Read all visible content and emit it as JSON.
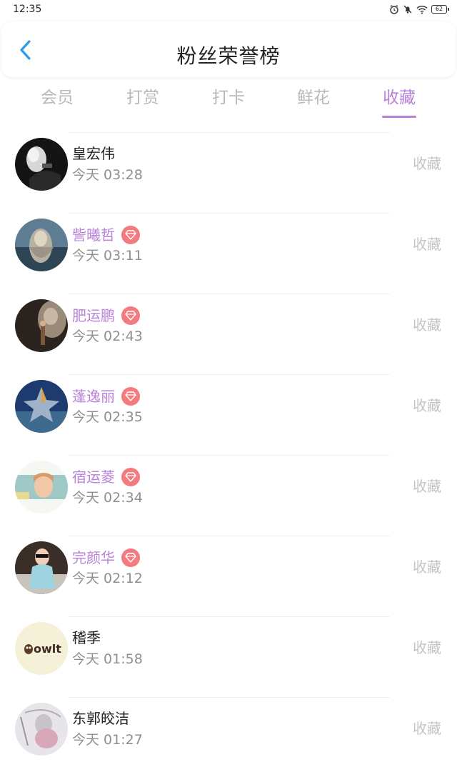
{
  "status_bar": {
    "time": "12:35",
    "battery": "62",
    "icons": [
      "alarm-icon",
      "mute-icon",
      "wifi-icon",
      "battery-icon"
    ]
  },
  "header": {
    "back_icon": "chevron-left-icon",
    "title": "粉丝荣誉榜"
  },
  "tabs": [
    {
      "label": "会员",
      "active": false
    },
    {
      "label": "打赏",
      "active": false
    },
    {
      "label": "打卡",
      "active": false
    },
    {
      "label": "鲜花",
      "active": false
    },
    {
      "label": "收藏",
      "active": true
    }
  ],
  "colors": {
    "accent": "#b882d8",
    "badge": "#f37b7f",
    "muted": "#c4c4c4",
    "time": "#8f8f8f",
    "back": "#2f9be8"
  },
  "rows": [
    {
      "name": "皇宏伟",
      "time": "今天 03:28",
      "action": "收藏",
      "vip": false
    },
    {
      "name": "訾曦哲",
      "time": "今天 03:11",
      "action": "收藏",
      "vip": true
    },
    {
      "name": "肥运鹏",
      "time": "今天 02:43",
      "action": "收藏",
      "vip": true
    },
    {
      "name": "蓬逸丽",
      "time": "今天 02:35",
      "action": "收藏",
      "vip": true
    },
    {
      "name": "宿运菱",
      "time": "今天 02:34",
      "action": "收藏",
      "vip": true
    },
    {
      "name": "完颜华",
      "time": "今天 02:12",
      "action": "收藏",
      "vip": true
    },
    {
      "name": "稽季",
      "time": "今天 01:58",
      "action": "收藏",
      "vip": false
    },
    {
      "name": "东郭皎洁",
      "time": "今天 01:27",
      "action": "收藏",
      "vip": false
    }
  ],
  "avatar_text": {
    "owl_logo": "owlt"
  }
}
